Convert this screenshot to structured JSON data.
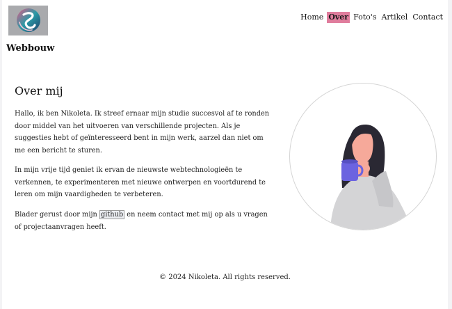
{
  "header": {
    "brand": "Webbouw",
    "logo_icon": "s-swirl-logo-icon"
  },
  "nav": {
    "items": [
      {
        "label": "Home",
        "active": false
      },
      {
        "label": "Over",
        "active": true
      },
      {
        "label": "Foto's",
        "active": false
      },
      {
        "label": "Artikel",
        "active": false
      },
      {
        "label": "Contact",
        "active": false
      }
    ],
    "active_color": "#e07d9d"
  },
  "about": {
    "title": "Over mij",
    "paragraph1": "Hallo, ik ben Nikoleta. Ik streef ernaar mijn studie succesvol af te ronden door middel van het uitvoeren van verschillende projecten. Als je suggesties hebt of geïnteresseerd bent in mijn werk, aarzel dan niet om me een bericht te sturen.",
    "paragraph2": "In mijn vrije tijd geniet ik ervan de nieuwste webtechnologieën te verkennen, te experimenteren met nieuwe ontwerpen en voortdurend te leren om mijn vaardigheden te verbeteren.",
    "paragraph3_before": "Blader gerust door mijn ",
    "paragraph3_link": "github",
    "paragraph3_after": " en neem contact met mij op als u vragen of projectaanvragen heeft.",
    "illustration": "woman-drinking-coffee-illustration"
  },
  "footer": {
    "text": "© 2024 Nikoleta. All rights reserved."
  }
}
